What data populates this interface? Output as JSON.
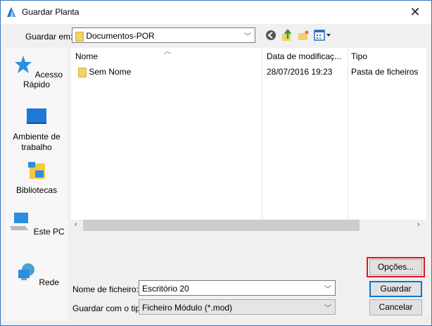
{
  "window": {
    "title": "Guardar Planta",
    "close_icon": "close-icon"
  },
  "location": {
    "label": "Guardar em:",
    "value": "Documentos-POR"
  },
  "toolbar": {
    "back": "back-icon",
    "up": "up-folder-icon",
    "new_folder": "new-folder-icon",
    "view": "view-menu-icon"
  },
  "sidebar": {
    "items": [
      {
        "label": "Acesso Rápido"
      },
      {
        "label": "Ambiente de trabalho"
      },
      {
        "label": "Bibliotecas"
      },
      {
        "label": "Este PC"
      },
      {
        "label": "Rede"
      }
    ]
  },
  "file_list": {
    "columns": [
      "Nome",
      "Data de modificaç...",
      "Tipo"
    ],
    "rows": [
      {
        "name": "Sem Nome",
        "date": "28/07/2016 19:23",
        "type": "Pasta de ficheiros"
      }
    ]
  },
  "form": {
    "filename_label": "Nome de ficheiro:",
    "filename_value": "Escritório 20",
    "type_label": "Guardar com o tipo:",
    "type_value": "Ficheiro Módulo (*.mod)"
  },
  "buttons": {
    "options": "Opções...",
    "save": "Guardar",
    "cancel": "Cancelar"
  },
  "colors": {
    "accent": "#0078d7",
    "highlight": "#e81123"
  }
}
